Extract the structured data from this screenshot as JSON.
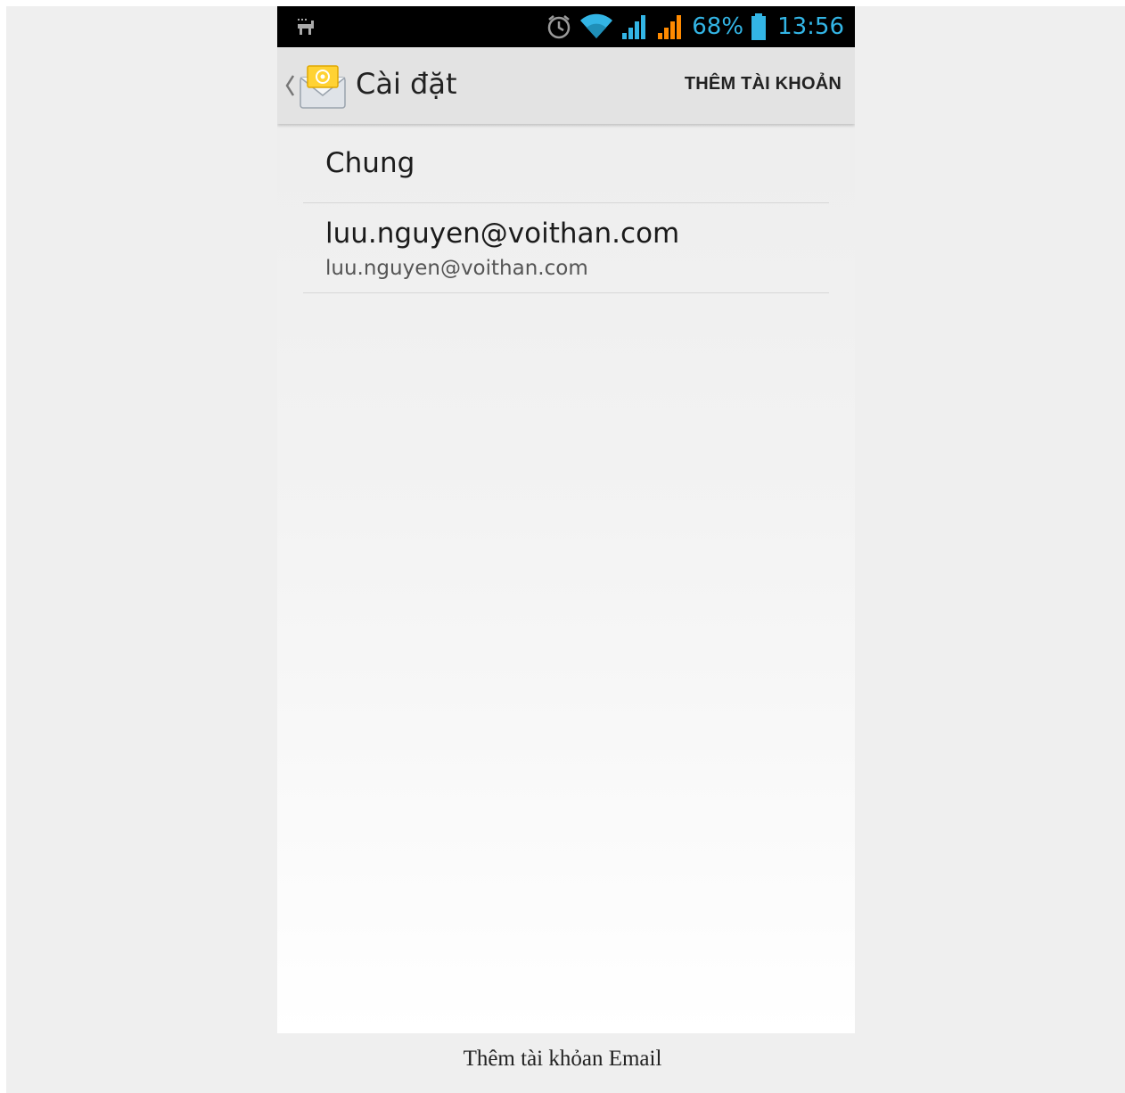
{
  "status_bar": {
    "notification_icon": "usb-notification-icon",
    "icons": [
      "alarm-icon",
      "wifi-icon",
      "signal-icon",
      "signal-icon"
    ],
    "battery_percent": "68%",
    "time": "13:56",
    "accent_color": "#33b5e5"
  },
  "action_bar": {
    "back_icon": "chevron-left-icon",
    "app_icon": "email-envelope-icon",
    "title": "Cài đặt",
    "add_account_label": "THÊM TÀI KHOẢN"
  },
  "settings_list": {
    "general": "Chung",
    "account": {
      "title": "luu.nguyen@voithan.com",
      "subtitle": "luu.nguyen@voithan.com"
    }
  },
  "caption": "Thêm tài khỏan Email"
}
